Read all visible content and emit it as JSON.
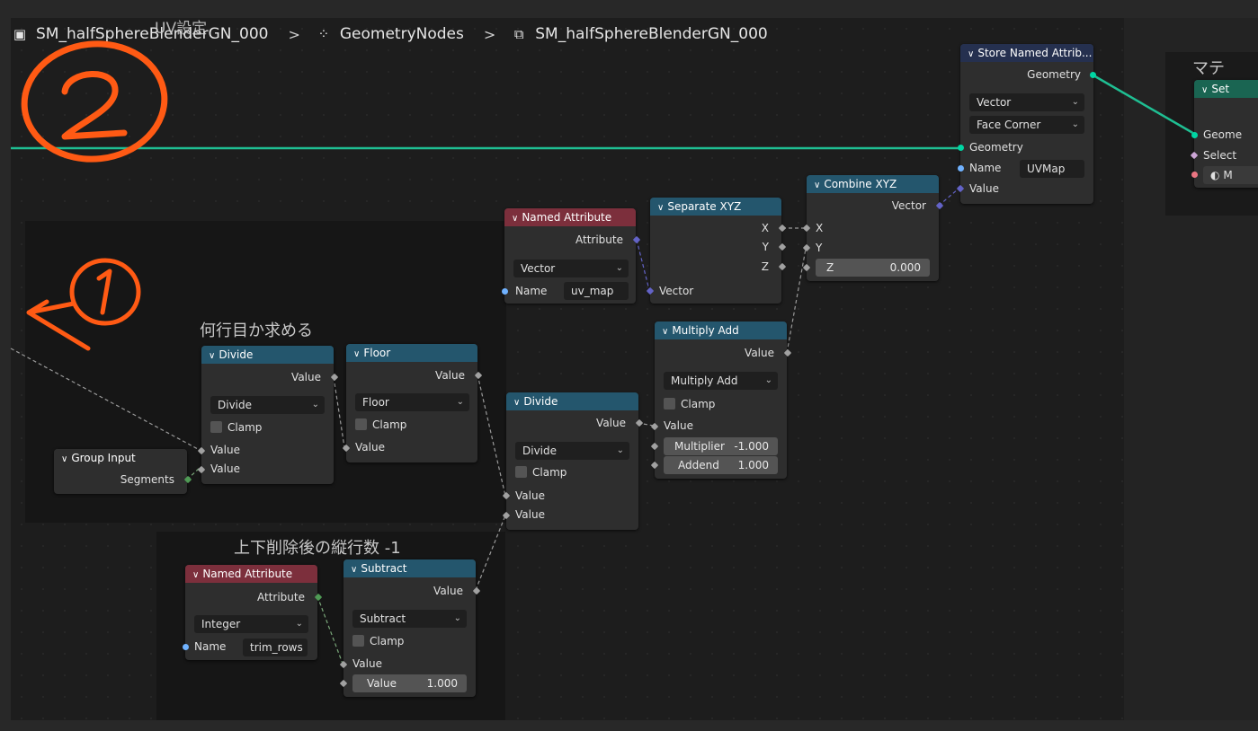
{
  "breadcrumb": {
    "object": "SM_halfSphereBlenderGN_000",
    "modifier": "GeometryNodes",
    "node_group": "SM_halfSphereBlenderGN_000",
    "overlay_label": "UV設定"
  },
  "frames": {
    "row_label": "何行目か求める",
    "rows_label": "上下削除後の縦行数 -1",
    "material_label": "マテ"
  },
  "annotations": {
    "circled_two": "②",
    "circled_one": "①"
  },
  "nodes": {
    "store_named": {
      "title": "Store Named Attrib...",
      "out_geometry": "Geometry",
      "data_type": "Vector",
      "domain": "Face Corner",
      "in_geometry": "Geometry",
      "name_label": "Name",
      "name_value": "UVMap",
      "in_value": "Value"
    },
    "set_material": {
      "title": "Set",
      "geometry": "Geome",
      "selection": "Select",
      "material": "M"
    },
    "named_attr_uv": {
      "title": "Named Attribute",
      "out_attribute": "Attribute",
      "data_type": "Vector",
      "name_label": "Name",
      "name_value": "uv_map"
    },
    "separate_xyz": {
      "title": "Separate XYZ",
      "x": "X",
      "y": "Y",
      "z": "Z",
      "in_vector": "Vector"
    },
    "combine_xyz": {
      "title": "Combine XYZ",
      "out_vector": "Vector",
      "x": "X",
      "y": "Y",
      "z_label": "Z",
      "z_value": "0.000"
    },
    "multiply_add": {
      "title": "Multiply Add",
      "out_value": "Value",
      "operation": "Multiply Add",
      "clamp": "Clamp",
      "in_value": "Value",
      "multiplier_label": "Multiplier",
      "multiplier_value": "-1.000",
      "addend_label": "Addend",
      "addend_value": "1.000"
    },
    "divide1": {
      "title": "Divide",
      "out_value": "Value",
      "operation": "Divide",
      "clamp": "Clamp",
      "in_value_a": "Value",
      "in_value_b": "Value"
    },
    "floor": {
      "title": "Floor",
      "out_value": "Value",
      "operation": "Floor",
      "clamp": "Clamp",
      "in_value": "Value"
    },
    "divide2": {
      "title": "Divide",
      "out_value": "Value",
      "operation": "Divide",
      "clamp": "Clamp",
      "in_value_a": "Value",
      "in_value_b": "Value"
    },
    "group_input": {
      "title": "Group Input",
      "segments": "Segments"
    },
    "named_attr_trim": {
      "title": "Named Attribute",
      "out_attribute": "Attribute",
      "data_type": "Integer",
      "name_label": "Name",
      "name_value": "trim_rows"
    },
    "subtract": {
      "title": "Subtract",
      "out_value": "Value",
      "operation": "Subtract",
      "clamp": "Clamp",
      "in_value": "Value",
      "value_label": "Value",
      "value_value": "1.000"
    }
  },
  "colors": {
    "geometry_link": "#1fbf93",
    "annotation": "#ff5a14",
    "header_blue": "#24566d",
    "header_red": "#7c2f3c"
  }
}
